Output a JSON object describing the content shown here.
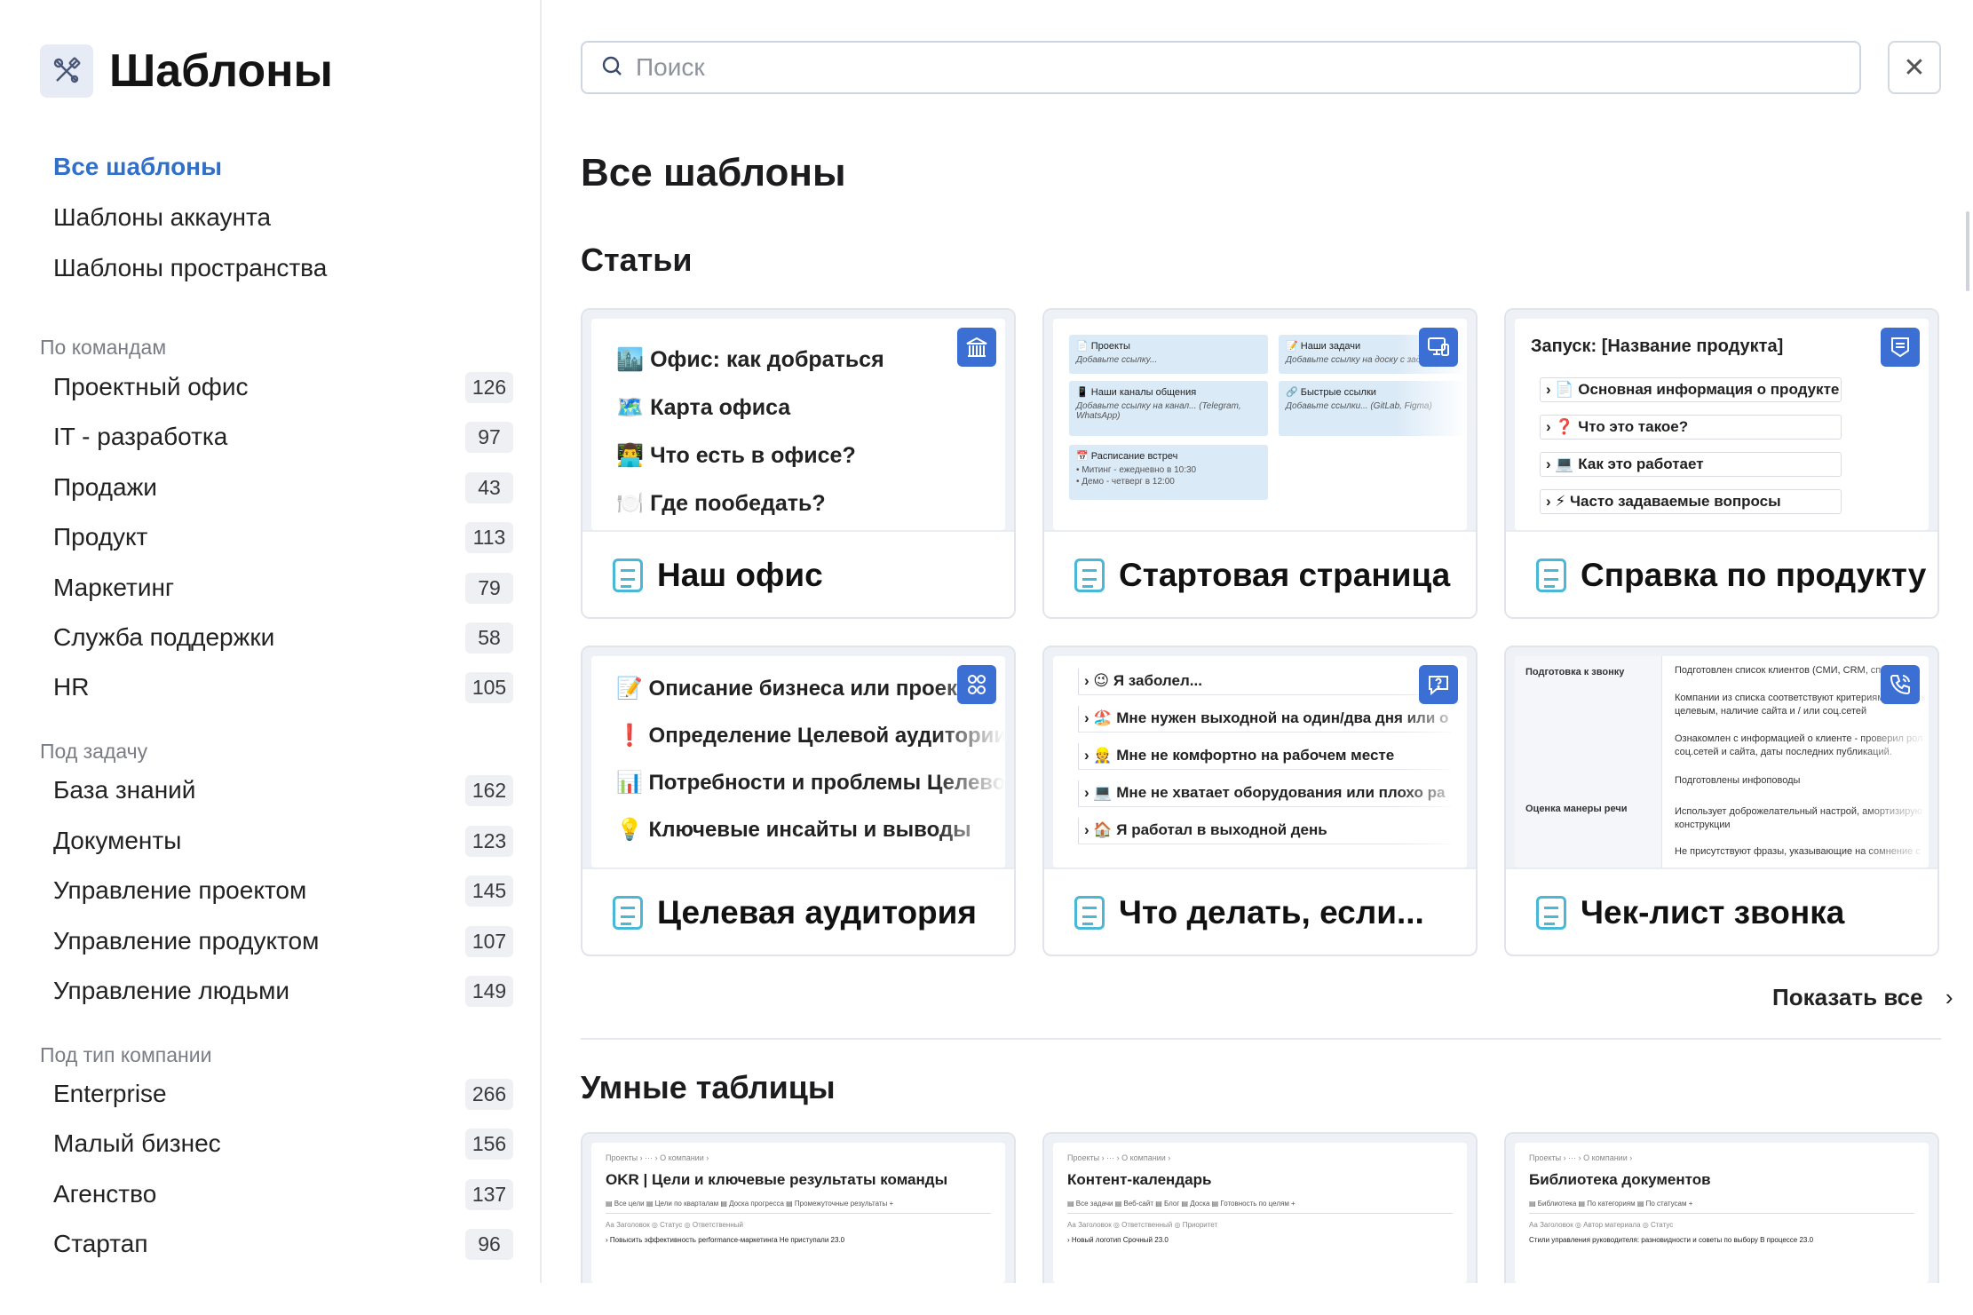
{
  "app": {
    "title": "Шаблоны"
  },
  "search": {
    "placeholder": "Поиск"
  },
  "nav": {
    "items": [
      {
        "label": "Все шаблоны",
        "active": true
      },
      {
        "label": "Шаблоны аккаунта"
      },
      {
        "label": "Шаблоны пространства"
      }
    ]
  },
  "groups": [
    {
      "title": "По командам",
      "items": [
        {
          "label": "Проектный офис",
          "count": "126"
        },
        {
          "label": "IT - разработка",
          "count": "97"
        },
        {
          "label": "Продажи",
          "count": "43"
        },
        {
          "label": "Продукт",
          "count": "113"
        },
        {
          "label": "Маркетинг",
          "count": "79"
        },
        {
          "label": "Служба поддержки",
          "count": "58"
        },
        {
          "label": "HR",
          "count": "105"
        }
      ]
    },
    {
      "title": "Под задачу",
      "items": [
        {
          "label": "База знаний",
          "count": "162"
        },
        {
          "label": "Документы",
          "count": "123"
        },
        {
          "label": "Управление проектом",
          "count": "145"
        },
        {
          "label": "Управление продуктом",
          "count": "107"
        },
        {
          "label": "Управление людьми",
          "count": "149"
        }
      ]
    },
    {
      "title": "Под тип компании",
      "items": [
        {
          "label": "Enterprise",
          "count": "266"
        },
        {
          "label": "Малый бизнес",
          "count": "156"
        },
        {
          "label": "Агенство",
          "count": "137"
        },
        {
          "label": "Стартап",
          "count": "96"
        }
      ]
    }
  ],
  "main": {
    "title": "Все шаблоны",
    "articles_title": "Статьи",
    "show_all": "Показать все",
    "tables_title": "Умные таблицы"
  },
  "cards": [
    {
      "title": "Наш офис",
      "icon": "building-icon",
      "preview": [
        "🏙️ Офис: как добраться",
        "🗺️ Карта офиса",
        "👨‍💻 Что есть в офисе?",
        "🍽️ Где пообедать?"
      ]
    },
    {
      "title": "Стартовая страница",
      "icon": "devices-icon",
      "preview": {
        "b1": "📄 Проекты",
        "b1i": "Добавьте ссылку...",
        "b2": "📝 Наши задачи",
        "b2i": "Добавьте ссылку на доску с зада",
        "b3": "📱 Наши каналы общения",
        "b3i": "Добавьте ссылку на канал... (Telegram, WhatsApp)",
        "b4": "🔗 Быстрые ссылки",
        "b4i": "Добавьте ссылки... (GitLab, Figma)",
        "b5": "📅 Расписание встреч",
        "b5a": "• Митинг - ежедневно в 10:30",
        "b5b": "• Демо - четверг в 12:00"
      }
    },
    {
      "title": "Справка по продукту",
      "icon": "shield-icon",
      "preview": {
        "heading": "Запуск: [Название продукта]",
        "items": [
          "› 📄 Основная информация о продукте",
          "› ❓ Что это такое?",
          "› 💻 Как это работает",
          "› ⚡ Часто задаваемые вопросы"
        ]
      }
    },
    {
      "title": "Целевая аудитория",
      "icon": "group-icon",
      "preview": [
        "📝 Описание бизнеса или проекта",
        "❗ Определение Целевой аудитории",
        "📊 Потребности и проблемы Целевой",
        "💡 Ключевые инсайты и выводы"
      ]
    },
    {
      "title": "Что делать, если...",
      "icon": "help-chat-icon",
      "preview": [
        "› 😉 Я заболел...",
        "› 🏖️ Мне нужен выходной на один/два дня или о",
        "› 👷 Мне не комфортно на рабочем месте",
        "› 💻 Мне не хватает оборудования или плохо ра",
        "› 🏠 Я работал в выходной день"
      ]
    },
    {
      "title": "Чек-лист звонка",
      "icon": "phone-icon",
      "preview": {
        "left1": "Подготовка к звонку",
        "left2": "Оценка манеры речи",
        "right": [
          "Подготовлен список клиентов (СМИ, CRM, справоч",
          "Компании из списка соответствуют критериям: сфера к целевым, наличие сайта и / или соц.сетей",
          "Ознакомлен с информацией о клиенте - проверил рол соц.сетей и сайта, даты последних публикаций.",
          "Подготовлены инфоповоды",
          "Использует доброжелательный настрой, амортизирую конструкции",
          "Не присутствуют фразы, указывающие на сомнение с"
        ]
      }
    }
  ],
  "tables": [
    {
      "crumb": "Проекты › ··· › О компании ›",
      "title": "OKR | Цели и ключевые результаты команды",
      "tabs": "▤ Все цели   ▤ Цели по кварталам   ▤ Доска прогресса   ▤ Промежуточные результаты   +",
      "hdr": "Аа Заголовок                              ◎ Статус                   ◎ Ответственный",
      "row": "› Повысить эффективность performance-маркетинга     Не приступали       23.0"
    },
    {
      "crumb": "Проекты › ··· › О компании ›",
      "title": "Контент-календарь",
      "tabs": "▤ Все задачи   ▤ Веб-сайт   ▤ Блог   ▤ Доска   ▤ Готовность по целям   +",
      "hdr": "Аа Заголовок                              ◎ Ответственный          ◎ Приоритет",
      "row": "› Новый логотип                                         Срочный      23.0"
    },
    {
      "crumb": "Проекты › ··· › О компании ›",
      "title": "Библиотека документов",
      "tabs": "▤ Библиотека   ▤ По категориям   ▤ По статусам   +",
      "hdr": "Аа Заголовок                              ◎ Автор материала        ◎ Статус",
      "row": "Стили управления руководителя: разновидности и советы по выбору   В процессе   23.0"
    }
  ]
}
